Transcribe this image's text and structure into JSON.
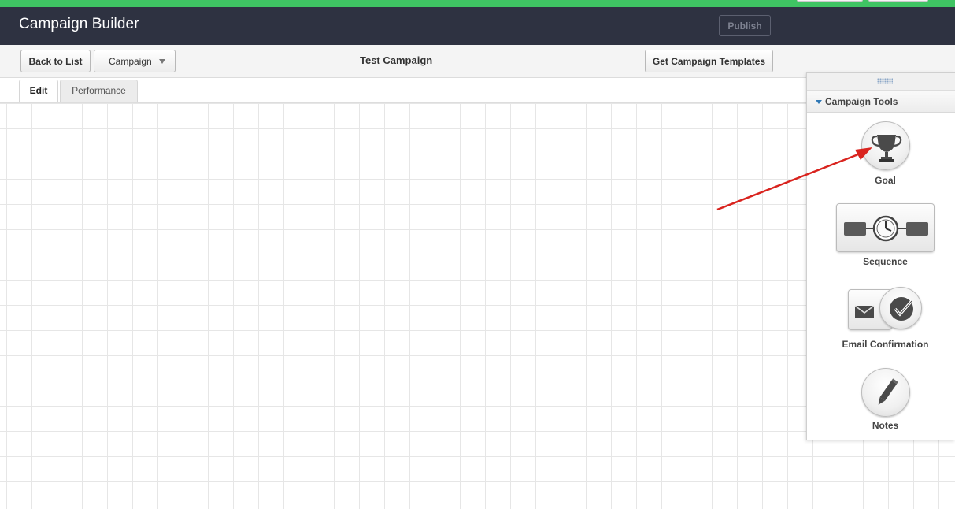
{
  "app": {
    "title": "Campaign Builder",
    "publish_label": "Publish"
  },
  "toolbar": {
    "back_label": "Back to List",
    "campaign_select": "Campaign",
    "campaign_name": "Test Campaign",
    "templates_label": "Get Campaign Templates"
  },
  "tabs": [
    {
      "label": "Edit",
      "active": true
    },
    {
      "label": "Performance",
      "active": false
    }
  ],
  "tools_panel": {
    "title": "Campaign Tools",
    "items": [
      {
        "label": "Goal",
        "icon": "trophy-icon"
      },
      {
        "label": "Sequence",
        "icon": "sequence-timer-icon"
      },
      {
        "label": "Email Confirmation",
        "icon": "email-confirmation-icon"
      },
      {
        "label": "Notes",
        "icon": "pencil-icon"
      }
    ]
  },
  "colors": {
    "accent_strip": "#3fc463",
    "header_bg": "#2e3241",
    "annotation_arrow": "#d9231e"
  }
}
